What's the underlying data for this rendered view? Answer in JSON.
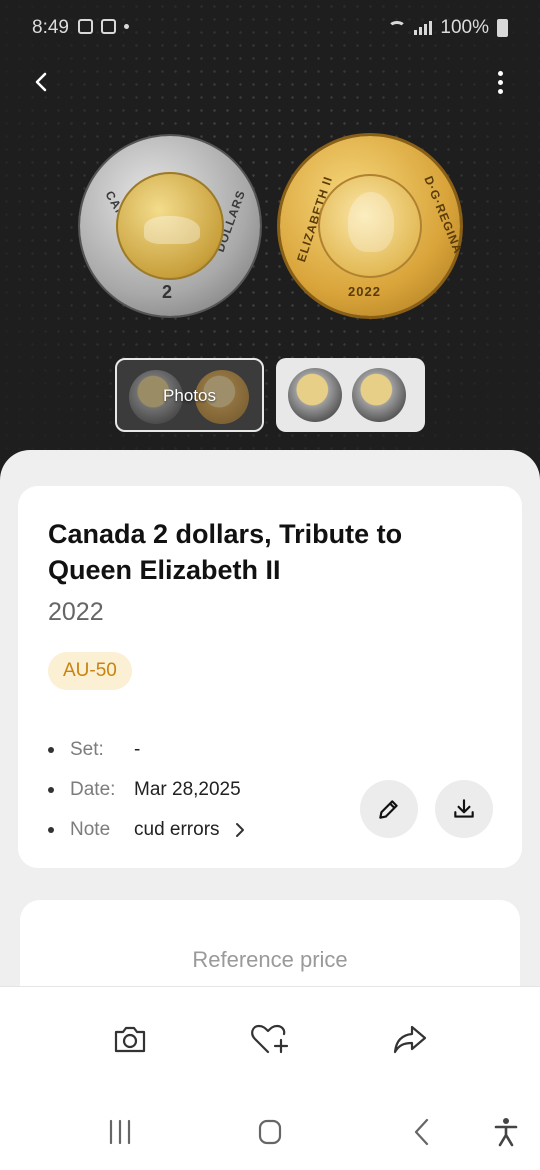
{
  "status_bar": {
    "time": "8:49",
    "battery": "100%"
  },
  "hero": {
    "coin_reverse": {
      "legend_left": "CANADA",
      "legend_right": "DOLLARS",
      "denomination": "2"
    },
    "coin_obverse": {
      "legend_left": "ELIZABETH II",
      "legend_right": "D·G·REGINA",
      "year": "2022"
    },
    "thumbnails": [
      {
        "label": "Photos",
        "selected": true
      },
      {
        "label": "",
        "selected": false
      }
    ]
  },
  "coin": {
    "title": "Canada 2 dollars, Tribute to Queen Elizabeth II",
    "year": "2022",
    "grade": "AU-50"
  },
  "details": [
    {
      "label": "Set:",
      "value": "-"
    },
    {
      "label": "Date:",
      "value": "Mar 28,2025"
    },
    {
      "label": "Note",
      "value": "cud errors"
    }
  ],
  "reference_price": {
    "label": "Reference price"
  },
  "colors": {
    "grade_badge_bg": "#fbefd4",
    "grade_badge_text": "#c88410",
    "hero_bg": "#1e1e1e"
  },
  "icons": {
    "back": "chevron-left-icon",
    "more": "more-vert-icon",
    "edit": "pencil-icon",
    "download": "download-icon",
    "camera": "camera-icon",
    "favorite": "heart-plus-icon",
    "share": "share-icon"
  }
}
